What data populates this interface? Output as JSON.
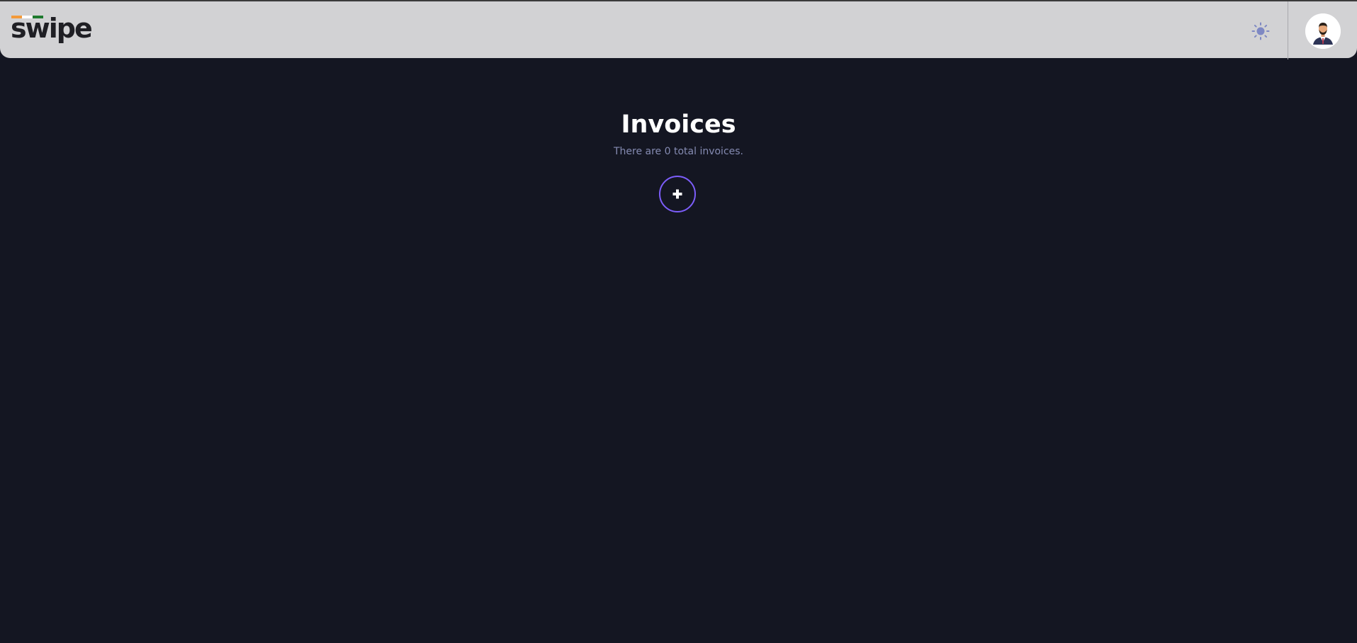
{
  "header": {
    "logo_text": "swipe",
    "logo_flag_colors": [
      "#f39a3a",
      "#ffffff",
      "#1e7a2e"
    ],
    "theme_toggle_icon": "sun-icon",
    "avatar_icon": "user-avatar"
  },
  "main": {
    "title": "Invoices",
    "subtitle": "There are 0 total invoices.",
    "add_button_icon": "plus-icon"
  },
  "colors": {
    "background": "#141622",
    "header": "#d2d2d4",
    "accent": "#7c5dfa",
    "muted_text": "#858bb2"
  }
}
